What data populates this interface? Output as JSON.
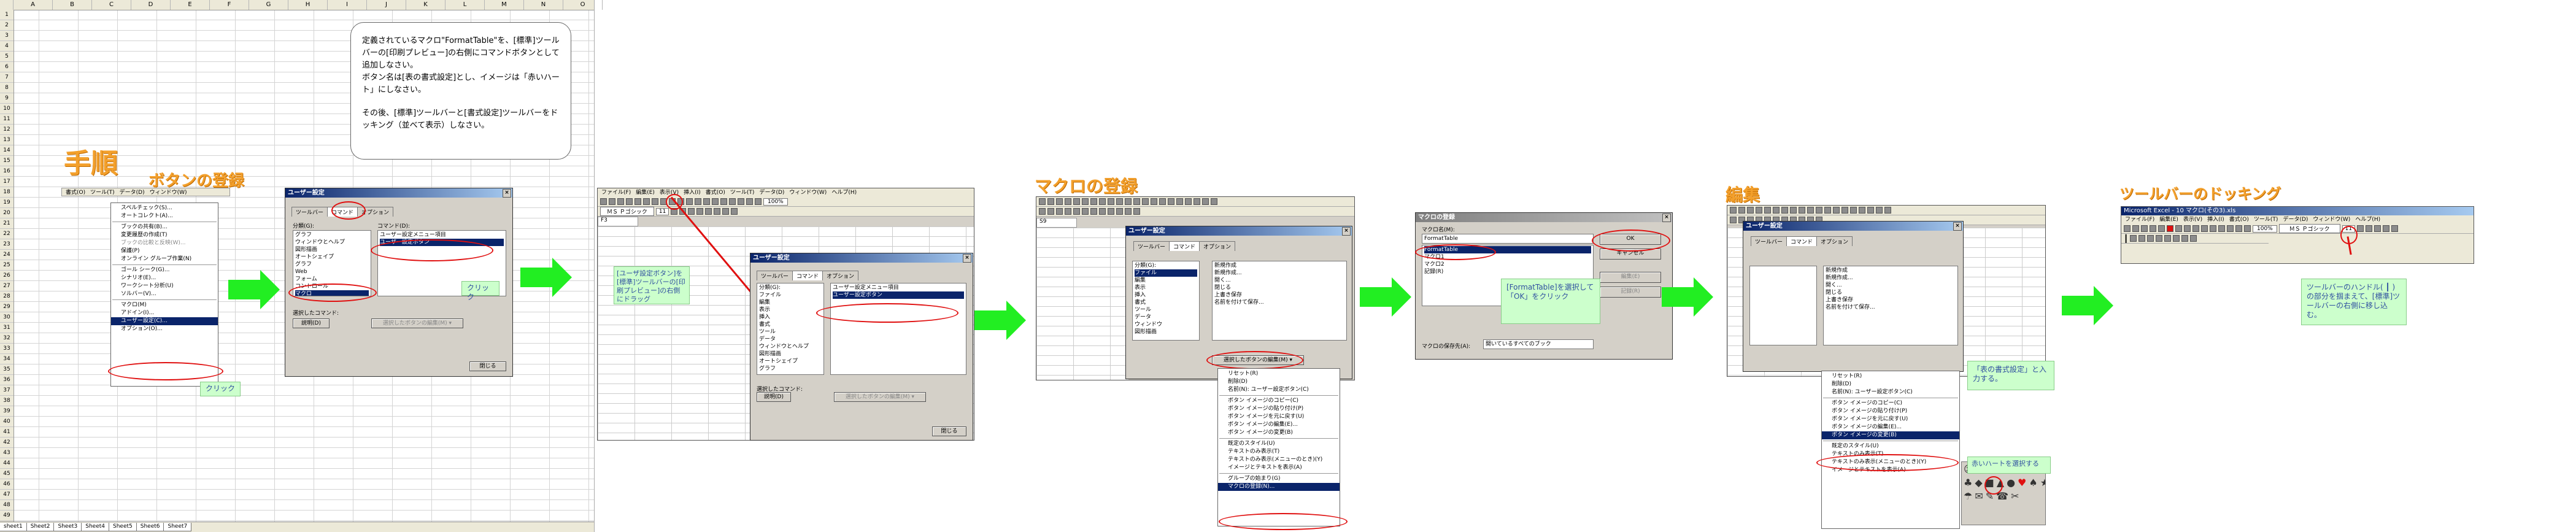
{
  "sheet": {
    "columns": [
      "A",
      "B",
      "C",
      "D",
      "E",
      "F",
      "G",
      "H",
      "I",
      "J",
      "K",
      "L",
      "M",
      "N",
      "O"
    ],
    "rows": [
      1,
      2,
      3,
      4,
      5,
      6,
      7,
      8,
      9,
      10,
      11,
      12,
      13,
      14,
      15,
      16,
      17,
      18,
      19,
      20,
      21,
      22,
      23,
      24,
      25,
      26,
      27,
      28,
      29,
      30,
      31,
      32,
      33,
      34,
      35,
      36,
      37,
      38,
      39,
      40,
      41,
      42,
      43,
      44,
      45,
      46,
      47,
      48,
      49,
      50
    ],
    "tabs": [
      "sheet1",
      "Sheet2",
      "Sheet3",
      "Sheet4",
      "Sheet5",
      "Sheet6",
      "Sheet7"
    ],
    "heading_procedure": "手順",
    "heading_register_button": "ボタンの登録"
  },
  "note": {
    "text1": "定義されているマクロ\"FormatTable\"を、[標準]ツールバーの[印刷プレビュー]の右側にコマンドボタンとして追加しなさい。",
    "text2": "ボタン名は[表の書式設定]とし、イメージは「赤いハート」にしなさい。",
    "text3": "その後、[標準]ツールバーと[書式設定]ツールバーをドッキング（並べて表示）しなさい。"
  },
  "panel1": {
    "menubar": [
      "ファイル(F)",
      "編集(E)",
      "表示(V)",
      "挿入(I)",
      "書式(O)",
      "ツール(T)",
      "データ(D)",
      "ウィンドウ(W)",
      "ヘルプ(H)"
    ],
    "context_menu": [
      "スペルチェック(S)...",
      "オートコレクト(A)...",
      "ブックの共有(B)...",
      "変更履歴の作成(T)",
      "ブックの比較と反映(W)...",
      "保護(P)",
      "オンライン グループ作業(N)",
      "ゴール シーク(G)...",
      "シナリオ(E)...",
      "ワークシート分析(U)",
      "ソルバー(V)...",
      "マクロ(M)",
      "アドイン(I)...",
      "ユーザー設定(C)...",
      "オプション(O)..."
    ],
    "callout": "クリック",
    "dialog": {
      "title": "ユーザー設定",
      "tabs": [
        "ツールバー",
        "コマンド",
        "オプション"
      ],
      "category_label": "分類(G):",
      "categories": [
        "グラフ",
        "ウィンドウとヘルプ",
        "図形描画",
        "オートシェイプ",
        "グラフ",
        "Web",
        "フォーム",
        "コントロール",
        "マクロ"
      ],
      "command_label": "コマンド(D):",
      "commands": [
        "ユーザー設定メニュー項目",
        "ユーザー設定ボタン"
      ],
      "selected_label": "選択したコマンド:",
      "desc_button": "説明(D)",
      "modify_button": "選択したボタンの編集(M) ▾",
      "close_button": "閉じる",
      "callout": "クリック"
    }
  },
  "panel2": {
    "menubar": [
      "ファイル(F)",
      "編集(E)",
      "表示(V)",
      "挿入(I)",
      "書式(O)",
      "ツール(T)",
      "データ(D)",
      "ウィンドウ(W)",
      "ヘルプ(H)"
    ],
    "font": "ＭＳ Ｐゴシック",
    "fontsize": "11",
    "zoom": "100%",
    "namebox": "F3",
    "callout": "[ユーザ設定ボタン]を[標準]ツールバーの[印刷プレビュー]の右側にドラッグ",
    "dialog": {
      "title": "ユーザー設定",
      "tabs": [
        "ツールバー",
        "コマンド",
        "オプション"
      ],
      "categories": [
        "分類(G):",
        "ファイル",
        "編集",
        "表示",
        "挿入",
        "書式",
        "ツール",
        "データ",
        "ウィンドウとヘルプ",
        "図形描画",
        "オートシェイプ",
        "グラフ",
        "Web",
        "フォーム",
        "コントロール",
        "組み込みのメニュー",
        "新しいメニュー"
      ],
      "commands": [
        "ユーザー設定メニュー項目",
        "ユーザー設定ボタン"
      ],
      "selected_label": "選択したコマンド:",
      "desc_button": "説明(D)",
      "modify_button": "選択したボタンの編集(M) ▾",
      "close_button": "閉じる"
    }
  },
  "panel3": {
    "heading": "マクロの登録",
    "namebox": "S9",
    "dialog_title": "ユーザー設定",
    "tabs": [
      "ツールバー",
      "コマンド",
      "オプション"
    ],
    "categories": [
      "分類(G):",
      "ファイル",
      "編集",
      "表示",
      "挿入",
      "書式",
      "ツール",
      "データ",
      "ウィンドウ",
      "図形描画",
      "オートシェイプ"
    ],
    "commands": [
      "新規作成",
      "新規作成...",
      "開く...",
      "閉じる",
      "上書き保存",
      "名前を付けて保存..."
    ],
    "modify_button": "選択したボタンの編集(M) ▾",
    "menu": [
      "リセット(R)",
      "削除(D)",
      "名前(N): ユーザー設定ボタン(C)",
      "ボタン イメージのコピー(C)",
      "ボタン イメージの貼り付け(P)",
      "ボタン イメージを元に戻す(U)",
      "ボタン イメージの編集(E)...",
      "ボタン イメージの変更(B)",
      "既定のスタイル(U)",
      "テキストのみ表示(T)",
      "テキストのみ表示(メニューのとき)(Y)",
      "イメージとテキストを表示(A)",
      "グループの始まり(G)",
      "マクロの登録(N)..."
    ]
  },
  "panel4": {
    "dialog_title": "マクロの登録",
    "macro_label": "マクロ名(M):",
    "macro_name": "FormatTable",
    "macro_list": [
      "FormatTable",
      "マクロ1",
      "マクロ2",
      "記録(R)"
    ],
    "ok": "OK",
    "cancel": "キャンセル",
    "edit": "編集(E)",
    "record": "記録(R)",
    "store_label": "マクロの保存先(A):",
    "store_value": "開いているすべてのブック",
    "callout": "[FormatTable]を選択して「OK」をクリック"
  },
  "panel5": {
    "heading": "編集",
    "dialog_title": "ユーザー設定",
    "tabs": [
      "ツールバー",
      "コマンド",
      "オプション"
    ],
    "name_value": "ユーザー設定ボタン(C)",
    "callout1": "「表の書式設定」と入力する。",
    "callout2": "赤いハートを選択する",
    "menu": [
      "リセット(R)",
      "削除(D)",
      "名前(N): ユーザー設定ボタン(C)",
      "ボタン イメージのコピー(C)",
      "ボタン イメージの貼り付け(P)",
      "ボタン イメージを元に戻す(U)",
      "ボタン イメージの編集(E)...",
      "ボタン イメージの変更(B)",
      "既定のスタイル(U)",
      "テキストのみ表示(T)",
      "テキストのみ表示(メニューのとき)(Y)",
      "イメージとテキストを表示(A)",
      "グループの始まり(G)",
      "マクロの登録(N)..."
    ],
    "heart": "♥"
  },
  "panel6": {
    "heading": "ツールバーのドッキング",
    "app_title": "Microsoft Excel - 10 マクロ(その3).xls",
    "menubar": [
      "ファイル(F)",
      "編集(E)",
      "表示(V)",
      "挿入(I)",
      "書式(O)",
      "ツール(T)",
      "データ(D)",
      "ウィンドウ(W)",
      "ヘルプ(H)"
    ],
    "font": "ＭＳ Ｐゴシック",
    "fontsize": "11",
    "zoom": "100%",
    "callout": "ツールバーのハンドル( ┃ )の部分を掴まえて、[標準]ツールバーの右側に移し込む。"
  },
  "colors": {
    "accent": "#e01010",
    "arrow": "#22ee22",
    "callout_bg": "#ccffcc",
    "heading": "#f3a02c"
  }
}
